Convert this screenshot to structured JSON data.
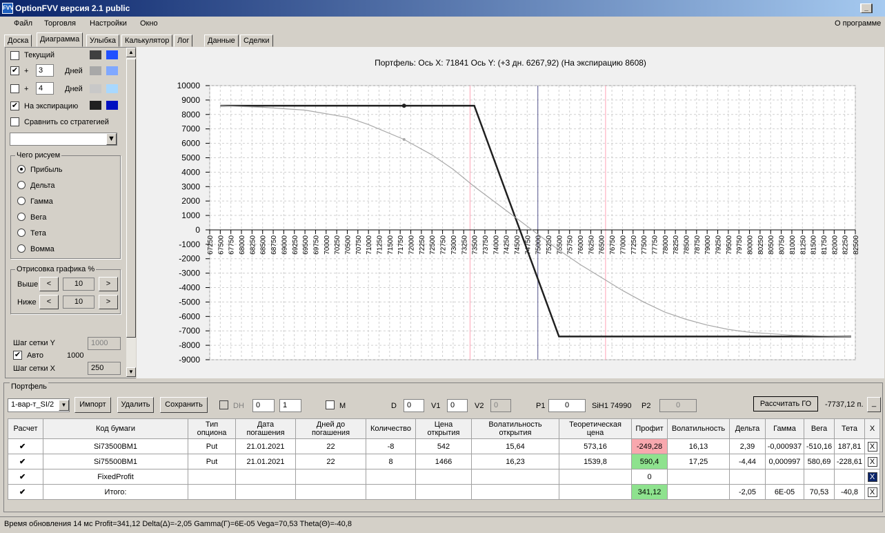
{
  "window": {
    "title": "OptionFVV версия 2.1 public",
    "min": "_",
    "max": "□",
    "close": "X"
  },
  "menu": {
    "items": [
      "Файл",
      "Торговля",
      "Настройки",
      "Окно"
    ],
    "about": "О программе"
  },
  "tabs": [
    "Доска",
    "Диаграмма",
    "Улыбка",
    "Калькулятор",
    "Лог",
    "Данные",
    "Сделки"
  ],
  "left": {
    "current_label": "Текущий",
    "plus1": "+",
    "days1_value": "3",
    "days1_label": "Дней",
    "plus2": "+",
    "days2_value": "4",
    "days2_label": "Дней",
    "expiry_label": "На экспирацию",
    "compare_label": "Сравнить со стратегией",
    "what_title": "Чего рисуем",
    "what_options": [
      "Прибыль",
      "Дельта",
      "Гамма",
      "Вега",
      "Тета",
      "Вомма"
    ],
    "draw_title": "Отрисовка графика %",
    "above_label": "Выше",
    "above_value": "10",
    "below_label": "Ниже",
    "below_value": "10",
    "prev": "<",
    "next": ">",
    "grid_y_label": "Шаг сетки Y",
    "grid_y_value": "1000",
    "auto_label": "Авто",
    "auto_value": "1000",
    "grid_x_label": "Шаг сетки X",
    "grid_x_value": "250",
    "colors": {
      "current": [
        "#404040",
        "#2050ff"
      ],
      "days1": [
        "#a8a8a8",
        "#80a8ff"
      ],
      "days2": [
        "#c8c8c8",
        "#a8d8ff"
      ],
      "expiry": [
        "#202020",
        "#0010c0"
      ]
    }
  },
  "chart_header": "Портфель: Ось X: 71841 Ось Y:  (+3 дн. 6267,92)  (На экспирацию 8608)",
  "chart_data": {
    "type": "line",
    "xlim": [
      67250,
      82500
    ],
    "ylim": [
      -9000,
      10000
    ],
    "x_ticks": [
      67250,
      67500,
      67750,
      68000,
      68250,
      68500,
      68750,
      69000,
      69250,
      69500,
      69750,
      70000,
      70250,
      70500,
      70750,
      71000,
      71250,
      71500,
      71750,
      72000,
      72250,
      72500,
      72750,
      73000,
      73250,
      73500,
      73750,
      74000,
      74250,
      74500,
      74750,
      75000,
      75250,
      75500,
      75750,
      76000,
      76250,
      76500,
      76750,
      77000,
      77250,
      77500,
      77750,
      78000,
      78250,
      78500,
      78750,
      79000,
      79250,
      79500,
      79750,
      80000,
      80250,
      80500,
      80750,
      81000,
      81250,
      81500,
      81750,
      82000,
      82250,
      82500
    ],
    "y_ticks": [
      10000,
      9000,
      8000,
      7000,
      6000,
      5000,
      4000,
      3000,
      2000,
      1000,
      0,
      -1000,
      -2000,
      -3000,
      -4000,
      -5000,
      -6000,
      -7000,
      -8000,
      -9000
    ],
    "series": [
      {
        "color": "#202020",
        "x": [
          67500,
          73400,
          73500,
          75500,
          82400
        ],
        "y": [
          8608,
          8608,
          8608,
          -7392,
          -7392
        ]
      },
      {
        "color": "#a8a8a8",
        "x": [
          67500,
          68500,
          69500,
          70500,
          71000,
          71841,
          72500,
          73000,
          73500,
          74000,
          74500,
          75000,
          75500,
          76000,
          76500,
          77000,
          77500,
          78000,
          78500,
          79000,
          79500,
          80000,
          81000,
          82400
        ],
        "y": [
          8600,
          8500,
          8300,
          7800,
          7300,
          6268,
          5200,
          4200,
          3000,
          1900,
          800,
          -300,
          -1400,
          -2400,
          -3300,
          -4200,
          -5000,
          -5700,
          -6200,
          -6600,
          -6900,
          -7100,
          -7300,
          -7392
        ]
      }
    ],
    "markers": [
      {
        "x": 71841,
        "y": 8608,
        "color": "#202020"
      },
      {
        "x": 71841,
        "y": 6268,
        "color": "#a8a8a8"
      }
    ],
    "vlines": [
      {
        "x": 73400,
        "color": "#ffb0c0"
      },
      {
        "x": 75000,
        "color": "#7070a0"
      },
      {
        "x": 76600,
        "color": "#ffb0c0"
      }
    ],
    "grid": true
  },
  "portfolio": {
    "group_title": "Портфель",
    "select_value": "1-вар-т_SI/2",
    "import": "Импорт",
    "delete": "Удалить",
    "save": "Сохранить",
    "dh": "DH",
    "dh_v1": "0",
    "dh_v2": "1",
    "m": "M",
    "d_label": "D",
    "d_value": "0",
    "v1_label": "V1",
    "v1_value": "0",
    "v2_label": "V2",
    "v2_value": "0",
    "p1_label": "P1",
    "p1_value": "0",
    "sih": "SiH1 74990",
    "p2_label": "P2",
    "p2_value": "0",
    "calc_go": "Рассчитать ГО",
    "go_value": "-7737,12 п.",
    "go_btn": "_"
  },
  "table": {
    "headers": [
      "Расчет",
      "Код бумаги",
      "Тип опциона",
      "Дата погашения",
      "Дней до погашения",
      "Количество",
      "Цена открытия",
      "Волатильность открытия",
      "Теоретическая цена",
      "Профит",
      "Волатильность",
      "Дельта",
      "Гамма",
      "Вега",
      "Тета",
      "X"
    ],
    "rows": [
      [
        "✔",
        "Si73500BM1",
        "Put",
        "21.01.2021",
        "22",
        "-8",
        "542",
        "15,64",
        "573,16",
        "-249,28",
        "16,13",
        "2,39",
        "-0,000937",
        "-510,16",
        "187,81",
        "X"
      ],
      [
        "✔",
        "Si75500BM1",
        "Put",
        "21.01.2021",
        "22",
        "8",
        "1466",
        "16,23",
        "1539,8",
        "590,4",
        "17,25",
        "-4,44",
        "0,000997",
        "580,69",
        "-228,61",
        "X"
      ],
      [
        "✔",
        "FixedProfit",
        "",
        "",
        "",
        "",
        "",
        "",
        "",
        "0",
        "",
        "",
        "",
        "",
        "",
        "X"
      ],
      [
        "✔",
        "Итого:",
        "",
        "",
        "",
        "",
        "",
        "",
        "",
        "341,12",
        "",
        "-2,05",
        "6E-05",
        "70,53",
        "-40,8",
        "X"
      ]
    ]
  },
  "status": "Время обновления 14 мс  Profit=341,12 Delta(Δ)=-2,05 Gamma(Γ)=6E-05 Vega=70,53 Theta(Θ)=-40,8"
}
